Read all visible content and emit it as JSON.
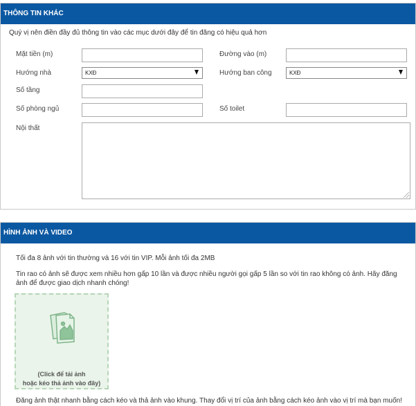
{
  "other_info": {
    "heading": "THÔNG TIN KHÁC",
    "intro": "Quý vị nên điền đầy đủ thông tin vào các mục dưới đây để tin đăng có hiệu quả hơn",
    "frontage_label": "Mặt tiền (m)",
    "road_label": "Đường vào (m)",
    "house_direction_label": "Hướng nhà",
    "house_direction_value": "KXĐ",
    "balcony_direction_label": "Hướng ban công",
    "balcony_direction_value": "KXĐ",
    "floors_label": "Số tầng",
    "bedrooms_label": "Số phòng ngủ",
    "toilets_label": "Số toilet",
    "interior_label": "Nội thất"
  },
  "media": {
    "heading": "HÌNH ẢNH VÀ VIDEO",
    "limit_note": "Tối đa 8 ảnh với tin thường và 16 với tin VIP. Mỗi ảnh tối đa 2MB",
    "benefit_note": "Tin rao có ảnh sẽ được xem nhiều hơn gấp 10 lần và được nhiều người gọi gấp 5 lần so với tin rao không có ảnh. Hãy đăng ảnh để được giao dịch nhanh chóng!",
    "upload_line1": "(Click để tải ảnh",
    "upload_line2": "hoặc kéo thả ảnh vào đây)",
    "upload_icon": "image-files-icon",
    "drag_note": "Đăng ảnh thật nhanh bằng cách kéo và thả ảnh vào khung. Thay đổi vị trí của ảnh bằng cách kéo ảnh vào vị trí mà bạn muốn!"
  },
  "colors": {
    "header_bg": "#0b58a2",
    "dropzone_bg": "#eaf4ea",
    "dropzone_border": "#b7d5b8"
  }
}
